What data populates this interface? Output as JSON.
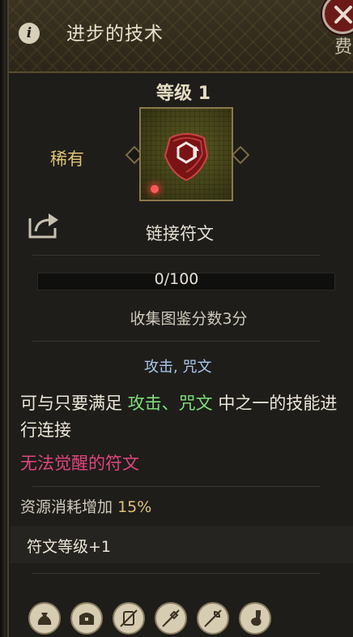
{
  "header": {
    "title": "进步的技术",
    "side_glyph": "费"
  },
  "rune": {
    "level_label": "等级",
    "level_value": "1",
    "rarity": "稀有",
    "name": "链接符文"
  },
  "collection": {
    "progress_text": "0/100",
    "progress_current": 0,
    "progress_max": 100,
    "score_text": "收集图鉴分数3分"
  },
  "tags": "攻击, 咒文",
  "description": {
    "prefix": "可与只要满足 ",
    "highlight": "攻击、咒文",
    "suffix": " 中之一的技能进行连接"
  },
  "warning": "无法觉醒的符文",
  "stat": {
    "label": "资源消耗增加",
    "value": "15",
    "unit": "%"
  },
  "rune_level_text": "符文等级+1",
  "bottom_icons": [
    "money-bag-icon",
    "treasure-chest-icon",
    "crossed-scroll-icon",
    "crossed-tools-icon",
    "crossed-wrench-icon",
    "potion-icon"
  ],
  "colors": {
    "accent_gold": "#e0c277",
    "highlight_green": "#7ee07a",
    "warning_pink": "#e0457f",
    "tag_blue": "#a9c7ea"
  }
}
